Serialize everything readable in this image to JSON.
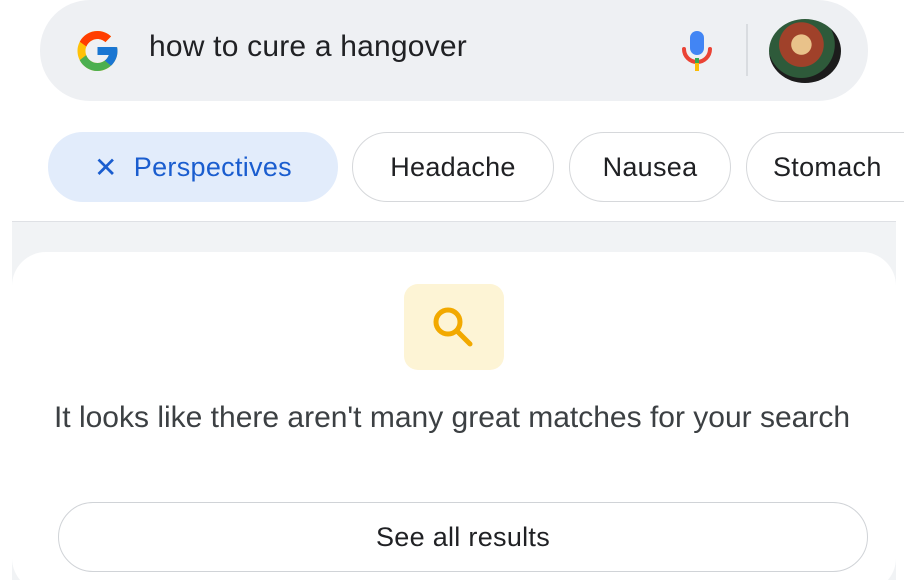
{
  "search": {
    "query": "how to cure a hangover",
    "logo_icon": "google-g-logo",
    "voice_icon": "microphone-icon",
    "avatar_icon": "user-avatar"
  },
  "chips": [
    {
      "label": "Perspectives",
      "active": true,
      "icon": "close-icon"
    },
    {
      "label": "Headache",
      "active": false
    },
    {
      "label": "Nausea",
      "active": false
    },
    {
      "label": "Stomach",
      "active": false
    }
  ],
  "empty_state": {
    "icon": "search-icon",
    "message": "It looks like there aren't many great matches for your search",
    "button_label": "See all results"
  },
  "colors": {
    "chip_active_bg": "#e2ecfb",
    "chip_active_text": "#1a5dcf",
    "icon_box_bg": "#fdf4d5",
    "search_icon": "#f2a900"
  }
}
